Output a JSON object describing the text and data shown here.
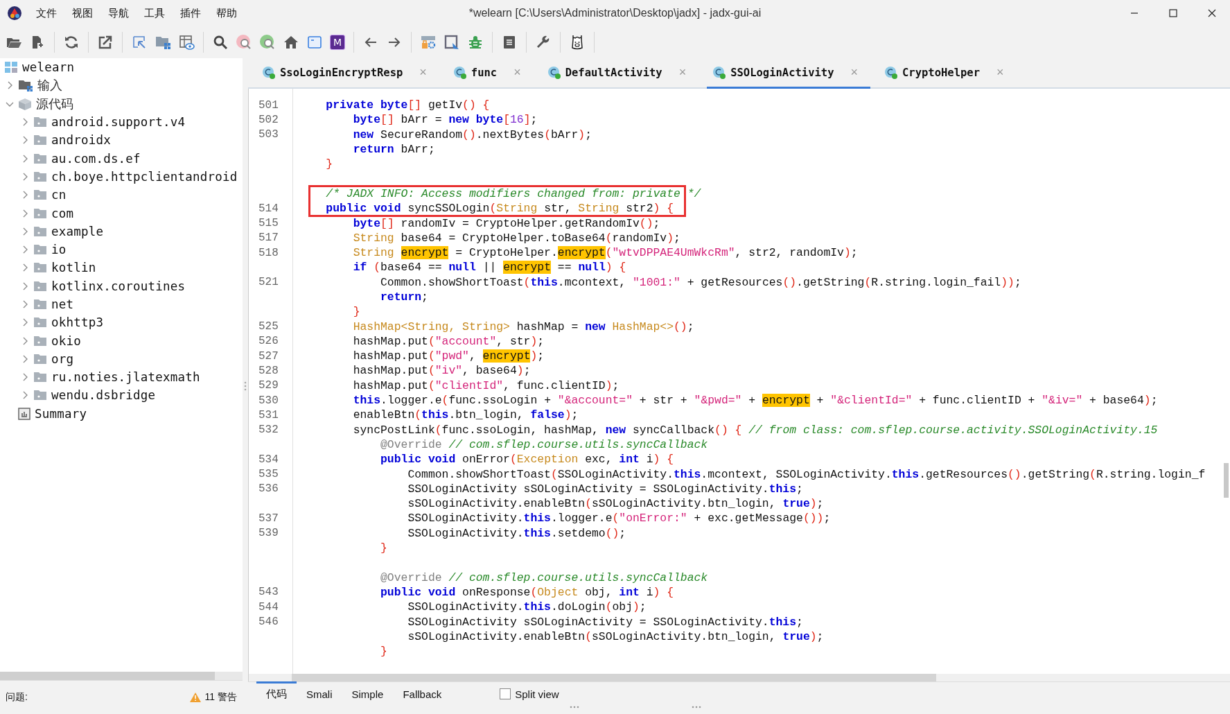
{
  "window": {
    "title": "*welearn [C:\\Users\\Administrator\\Desktop\\jadx] - jadx-gui-ai"
  },
  "menu": [
    "文件",
    "视图",
    "导航",
    "工具",
    "插件",
    "帮助"
  ],
  "toolbar": {
    "badge_letter": "M"
  },
  "tree": {
    "label": "welearn",
    "kind": "project",
    "children": [
      {
        "label": "输入",
        "kind": "input",
        "expanded": false
      },
      {
        "label": "源代码",
        "kind": "source",
        "expanded": true,
        "children": [
          {
            "label": "android.support.v4",
            "kind": "package",
            "expanded": false
          },
          {
            "label": "androidx",
            "kind": "package",
            "expanded": false
          },
          {
            "label": "au.com.ds.ef",
            "kind": "package",
            "expanded": false
          },
          {
            "label": "ch.boye.httpclientandroid",
            "kind": "package",
            "expanded": false
          },
          {
            "label": "cn",
            "kind": "package",
            "expanded": false
          },
          {
            "label": "com",
            "kind": "package",
            "expanded": false
          },
          {
            "label": "example",
            "kind": "package",
            "expanded": false
          },
          {
            "label": "io",
            "kind": "package",
            "expanded": false
          },
          {
            "label": "kotlin",
            "kind": "package",
            "expanded": false
          },
          {
            "label": "kotlinx.coroutines",
            "kind": "package",
            "expanded": false
          },
          {
            "label": "net",
            "kind": "package",
            "expanded": false
          },
          {
            "label": "okhttp3",
            "kind": "package",
            "expanded": false
          },
          {
            "label": "okio",
            "kind": "package",
            "expanded": false
          },
          {
            "label": "org",
            "kind": "package",
            "expanded": false
          },
          {
            "label": "ru.noties.jlatexmath",
            "kind": "package",
            "expanded": false
          },
          {
            "label": "wendu.dsbridge",
            "kind": "package",
            "expanded": false
          }
        ]
      },
      {
        "label": "Summary",
        "kind": "summary"
      }
    ]
  },
  "problems": {
    "label": "问题:",
    "warnings": "11 警告"
  },
  "tabs": [
    {
      "label": "SsoLoginEncryptResp",
      "selected": false,
      "close": "×"
    },
    {
      "label": "func",
      "selected": false,
      "close": "×"
    },
    {
      "label": "DefaultActivity",
      "selected": false,
      "close": "×"
    },
    {
      "label": "SSOLoginActivity",
      "selected": true,
      "close": "×"
    },
    {
      "label": "CryptoHelper",
      "selected": false,
      "close": "×"
    }
  ],
  "code": [
    {
      "kind": "code",
      "number": "501",
      "tokens": [
        {
          "kind": "kw",
          "text": "    private byte"
        },
        {
          "kind": "br",
          "text": "[]"
        },
        {
          "kind": "plain",
          "text": " getIv"
        },
        {
          "kind": "br",
          "text": "() {"
        }
      ]
    },
    {
      "kind": "code",
      "number": "502",
      "tokens": [
        {
          "kind": "kw",
          "text": "        byte"
        },
        {
          "kind": "br",
          "text": "[]"
        },
        {
          "kind": "plain",
          "text": " bArr = "
        },
        {
          "kind": "kw",
          "text": "new byte"
        },
        {
          "kind": "br",
          "text": "["
        },
        {
          "kind": "num",
          "text": "16"
        },
        {
          "kind": "br",
          "text": "]"
        },
        {
          "kind": "plain",
          "text": ";"
        }
      ]
    },
    {
      "kind": "code",
      "number": "503",
      "tokens": [
        {
          "kind": "kw",
          "text": "        new"
        },
        {
          "kind": "plain",
          "text": " SecureRandom"
        },
        {
          "kind": "br",
          "text": "()"
        },
        {
          "kind": "plain",
          "text": ".nextBytes"
        },
        {
          "kind": "br",
          "text": "("
        },
        {
          "kind": "plain",
          "text": "bArr"
        },
        {
          "kind": "br",
          "text": ")"
        },
        {
          "kind": "plain",
          "text": ";"
        }
      ]
    },
    {
      "kind": "code",
      "tokens": [
        {
          "kind": "kw",
          "text": "        return"
        },
        {
          "kind": "plain",
          "text": " bArr;"
        }
      ]
    },
    {
      "kind": "code",
      "tokens": [
        {
          "kind": "br",
          "text": "    }"
        }
      ]
    },
    {
      "kind": "blank"
    },
    {
      "kind": "code",
      "boxed": true,
      "tokens": [
        {
          "kind": "cmt",
          "text": "    /* JADX INFO: Access modifiers changed from: private */"
        }
      ]
    },
    {
      "kind": "code",
      "boxed": true,
      "number": "514",
      "tokens": [
        {
          "kind": "kw",
          "text": "    public void"
        },
        {
          "kind": "plain",
          "text": " syncSSOLogin"
        },
        {
          "kind": "br",
          "text": "("
        },
        {
          "kind": "type",
          "text": "String"
        },
        {
          "kind": "plain",
          "text": " str, "
        },
        {
          "kind": "type",
          "text": "String"
        },
        {
          "kind": "plain",
          "text": " str2"
        },
        {
          "kind": "br",
          "text": ") {"
        }
      ]
    },
    {
      "kind": "code",
      "number": "515",
      "tokens": [
        {
          "kind": "kw",
          "text": "        byte"
        },
        {
          "kind": "br",
          "text": "[]"
        },
        {
          "kind": "plain",
          "text": " randomIv = CryptoHelper.getRandomIv"
        },
        {
          "kind": "br",
          "text": "()"
        },
        {
          "kind": "plain",
          "text": ";"
        }
      ]
    },
    {
      "kind": "code",
      "number": "517",
      "tokens": [
        {
          "kind": "type",
          "text": "        String"
        },
        {
          "kind": "plain",
          "text": " base64 = CryptoHelper.toBase64"
        },
        {
          "kind": "br",
          "text": "("
        },
        {
          "kind": "plain",
          "text": "randomIv"
        },
        {
          "kind": "br",
          "text": ")"
        },
        {
          "kind": "plain",
          "text": ";"
        }
      ]
    },
    {
      "kind": "code",
      "number": "518",
      "tokens": [
        {
          "kind": "type",
          "text": "        String "
        },
        {
          "kind": "hl",
          "text": "encrypt"
        },
        {
          "kind": "plain",
          "text": " = CryptoHelper."
        },
        {
          "kind": "hl",
          "text": "encrypt"
        },
        {
          "kind": "br",
          "text": "("
        },
        {
          "kind": "str",
          "text": "\"wtvDPPAE4UmWkcRm\""
        },
        {
          "kind": "plain",
          "text": ", str2, randomIv"
        },
        {
          "kind": "br",
          "text": ")"
        },
        {
          "kind": "plain",
          "text": ";"
        }
      ]
    },
    {
      "kind": "code",
      "tokens": [
        {
          "kind": "kw",
          "text": "        if"
        },
        {
          "kind": "br",
          "text": " ("
        },
        {
          "kind": "plain",
          "text": "base64 == "
        },
        {
          "kind": "kw",
          "text": "null"
        },
        {
          "kind": "plain",
          "text": " || "
        },
        {
          "kind": "hl",
          "text": "encrypt"
        },
        {
          "kind": "plain",
          "text": " == "
        },
        {
          "kind": "kw",
          "text": "null"
        },
        {
          "kind": "br",
          "text": ") {"
        }
      ]
    },
    {
      "kind": "code",
      "number": "521",
      "tokens": [
        {
          "kind": "plain",
          "text": "            Common.showShortToast"
        },
        {
          "kind": "br",
          "text": "("
        },
        {
          "kind": "kw",
          "text": "this"
        },
        {
          "kind": "plain",
          "text": ".mcontext, "
        },
        {
          "kind": "str",
          "text": "\"1001:\""
        },
        {
          "kind": "plain",
          "text": " + getResources"
        },
        {
          "kind": "br",
          "text": "()"
        },
        {
          "kind": "plain",
          "text": ".getString"
        },
        {
          "kind": "br",
          "text": "("
        },
        {
          "kind": "plain",
          "text": "R.string.login_fail"
        },
        {
          "kind": "br",
          "text": "))"
        },
        {
          "kind": "plain",
          "text": ";"
        }
      ]
    },
    {
      "kind": "code",
      "tokens": [
        {
          "kind": "kw",
          "text": "            return"
        },
        {
          "kind": "plain",
          "text": ";"
        }
      ]
    },
    {
      "kind": "code",
      "tokens": [
        {
          "kind": "br",
          "text": "        }"
        }
      ]
    },
    {
      "kind": "code",
      "number": "525",
      "tokens": [
        {
          "kind": "type",
          "text": "        HashMap<String, String>"
        },
        {
          "kind": "plain",
          "text": " hashMap = "
        },
        {
          "kind": "kw",
          "text": "new"
        },
        {
          "kind": "type",
          "text": " HashMap<>"
        },
        {
          "kind": "br",
          "text": "()"
        },
        {
          "kind": "plain",
          "text": ";"
        }
      ]
    },
    {
      "kind": "code",
      "number": "526",
      "tokens": [
        {
          "kind": "plain",
          "text": "        hashMap.put"
        },
        {
          "kind": "br",
          "text": "("
        },
        {
          "kind": "str",
          "text": "\"account\""
        },
        {
          "kind": "plain",
          "text": ", str"
        },
        {
          "kind": "br",
          "text": ")"
        },
        {
          "kind": "plain",
          "text": ";"
        }
      ]
    },
    {
      "kind": "code",
      "number": "527",
      "tokens": [
        {
          "kind": "plain",
          "text": "        hashMap.put"
        },
        {
          "kind": "br",
          "text": "("
        },
        {
          "kind": "str",
          "text": "\"pwd\""
        },
        {
          "kind": "plain",
          "text": ", "
        },
        {
          "kind": "hl",
          "text": "encrypt"
        },
        {
          "kind": "br",
          "text": ")"
        },
        {
          "kind": "plain",
          "text": ";"
        }
      ]
    },
    {
      "kind": "code",
      "number": "528",
      "tokens": [
        {
          "kind": "plain",
          "text": "        hashMap.put"
        },
        {
          "kind": "br",
          "text": "("
        },
        {
          "kind": "str",
          "text": "\"iv\""
        },
        {
          "kind": "plain",
          "text": ", base64"
        },
        {
          "kind": "br",
          "text": ")"
        },
        {
          "kind": "plain",
          "text": ";"
        }
      ]
    },
    {
      "kind": "code",
      "number": "529",
      "tokens": [
        {
          "kind": "plain",
          "text": "        hashMap.put"
        },
        {
          "kind": "br",
          "text": "("
        },
        {
          "kind": "str",
          "text": "\"clientId\""
        },
        {
          "kind": "plain",
          "text": ", func.clientID"
        },
        {
          "kind": "br",
          "text": ")"
        },
        {
          "kind": "plain",
          "text": ";"
        }
      ]
    },
    {
      "kind": "code",
      "number": "530",
      "tokens": [
        {
          "kind": "kw",
          "text": "        this"
        },
        {
          "kind": "plain",
          "text": ".logger.e"
        },
        {
          "kind": "br",
          "text": "("
        },
        {
          "kind": "plain",
          "text": "func.ssoLogin + "
        },
        {
          "kind": "str",
          "text": "\"&account=\""
        },
        {
          "kind": "plain",
          "text": " + str + "
        },
        {
          "kind": "str",
          "text": "\"&pwd=\""
        },
        {
          "kind": "plain",
          "text": " + "
        },
        {
          "kind": "hl",
          "text": "encrypt"
        },
        {
          "kind": "plain",
          "text": " + "
        },
        {
          "kind": "str",
          "text": "\"&clientId=\""
        },
        {
          "kind": "plain",
          "text": " + func.clientID + "
        },
        {
          "kind": "str",
          "text": "\"&iv=\""
        },
        {
          "kind": "plain",
          "text": " + base64"
        },
        {
          "kind": "br",
          "text": ")"
        },
        {
          "kind": "plain",
          "text": ";"
        }
      ]
    },
    {
      "kind": "code",
      "number": "531",
      "tokens": [
        {
          "kind": "plain",
          "text": "        enableBtn"
        },
        {
          "kind": "br",
          "text": "("
        },
        {
          "kind": "kw",
          "text": "this"
        },
        {
          "kind": "plain",
          "text": ".btn_login, "
        },
        {
          "kind": "kw",
          "text": "false"
        },
        {
          "kind": "br",
          "text": ")"
        },
        {
          "kind": "plain",
          "text": ";"
        }
      ]
    },
    {
      "kind": "code",
      "number": "532",
      "tokens": [
        {
          "kind": "plain",
          "text": "        syncPostLink"
        },
        {
          "kind": "br",
          "text": "("
        },
        {
          "kind": "plain",
          "text": "func.ssoLogin, hashMap, "
        },
        {
          "kind": "kw",
          "text": "new"
        },
        {
          "kind": "plain",
          "text": " syncCallback"
        },
        {
          "kind": "br",
          "text": "() {"
        },
        {
          "kind": "cmt",
          "text": " // from class: com.sflep.course.activity.SSOLoginActivity.15"
        }
      ]
    },
    {
      "kind": "code",
      "tokens": [
        {
          "kind": "ann",
          "text": "            @Override"
        },
        {
          "kind": "cmt",
          "text": " // com.sflep.course.utils.syncCallback"
        }
      ]
    },
    {
      "kind": "code",
      "number": "534",
      "tokens": [
        {
          "kind": "kw",
          "text": "            public void"
        },
        {
          "kind": "plain",
          "text": " onError"
        },
        {
          "kind": "br",
          "text": "("
        },
        {
          "kind": "type",
          "text": "Exception"
        },
        {
          "kind": "plain",
          "text": " exc, "
        },
        {
          "kind": "kw",
          "text": "int"
        },
        {
          "kind": "plain",
          "text": " i"
        },
        {
          "kind": "br",
          "text": ") {"
        }
      ]
    },
    {
      "kind": "code",
      "number": "535",
      "tokens": [
        {
          "kind": "plain",
          "text": "                Common.showShortToast"
        },
        {
          "kind": "br",
          "text": "("
        },
        {
          "kind": "plain",
          "text": "SSOLoginActivity."
        },
        {
          "kind": "kw",
          "text": "this"
        },
        {
          "kind": "plain",
          "text": ".mcontext, SSOLoginActivity."
        },
        {
          "kind": "kw",
          "text": "this"
        },
        {
          "kind": "plain",
          "text": ".getResources"
        },
        {
          "kind": "br",
          "text": "()"
        },
        {
          "kind": "plain",
          "text": ".getString"
        },
        {
          "kind": "br",
          "text": "("
        },
        {
          "kind": "plain",
          "text": "R.string.login_f"
        }
      ]
    },
    {
      "kind": "code",
      "number": "536",
      "tokens": [
        {
          "kind": "plain",
          "text": "                SSOLoginActivity sSOLoginActivity = SSOLoginActivity."
        },
        {
          "kind": "kw",
          "text": "this"
        },
        {
          "kind": "plain",
          "text": ";"
        }
      ]
    },
    {
      "kind": "code",
      "tokens": [
        {
          "kind": "plain",
          "text": "                sSOLoginActivity.enableBtn"
        },
        {
          "kind": "br",
          "text": "("
        },
        {
          "kind": "plain",
          "text": "sSOLoginActivity.btn_login, "
        },
        {
          "kind": "kw",
          "text": "true"
        },
        {
          "kind": "br",
          "text": ")"
        },
        {
          "kind": "plain",
          "text": ";"
        }
      ]
    },
    {
      "kind": "code",
      "number": "537",
      "tokens": [
        {
          "kind": "plain",
          "text": "                SSOLoginActivity."
        },
        {
          "kind": "kw",
          "text": "this"
        },
        {
          "kind": "plain",
          "text": ".logger.e"
        },
        {
          "kind": "br",
          "text": "("
        },
        {
          "kind": "str",
          "text": "\"onError:\""
        },
        {
          "kind": "plain",
          "text": " + exc.getMessage"
        },
        {
          "kind": "br",
          "text": "())"
        },
        {
          "kind": "plain",
          "text": ";"
        }
      ]
    },
    {
      "kind": "code",
      "number": "539",
      "tokens": [
        {
          "kind": "plain",
          "text": "                SSOLoginActivity."
        },
        {
          "kind": "kw",
          "text": "this"
        },
        {
          "kind": "plain",
          "text": ".setdemo"
        },
        {
          "kind": "br",
          "text": "()"
        },
        {
          "kind": "plain",
          "text": ";"
        }
      ]
    },
    {
      "kind": "code",
      "tokens": [
        {
          "kind": "br",
          "text": "            }"
        }
      ]
    },
    {
      "kind": "blank"
    },
    {
      "kind": "code",
      "tokens": [
        {
          "kind": "ann",
          "text": "            @Override"
        },
        {
          "kind": "cmt",
          "text": " // com.sflep.course.utils.syncCallback"
        }
      ]
    },
    {
      "kind": "code",
      "number": "543",
      "tokens": [
        {
          "kind": "kw",
          "text": "            public void"
        },
        {
          "kind": "plain",
          "text": " onResponse"
        },
        {
          "kind": "br",
          "text": "("
        },
        {
          "kind": "type",
          "text": "Object"
        },
        {
          "kind": "plain",
          "text": " obj, "
        },
        {
          "kind": "kw",
          "text": "int"
        },
        {
          "kind": "plain",
          "text": " i"
        },
        {
          "kind": "br",
          "text": ") {"
        }
      ]
    },
    {
      "kind": "code",
      "number": "544",
      "tokens": [
        {
          "kind": "plain",
          "text": "                SSOLoginActivity."
        },
        {
          "kind": "kw",
          "text": "this"
        },
        {
          "kind": "plain",
          "text": ".doLogin"
        },
        {
          "kind": "br",
          "text": "("
        },
        {
          "kind": "plain",
          "text": "obj"
        },
        {
          "kind": "br",
          "text": ")"
        },
        {
          "kind": "plain",
          "text": ";"
        }
      ]
    },
    {
      "kind": "code",
      "number": "546",
      "tokens": [
        {
          "kind": "plain",
          "text": "                SSOLoginActivity sSOLoginActivity = SSOLoginActivity."
        },
        {
          "kind": "kw",
          "text": "this"
        },
        {
          "kind": "plain",
          "text": ";"
        }
      ]
    },
    {
      "kind": "code",
      "tokens": [
        {
          "kind": "plain",
          "text": "                sSOLoginActivity.enableBtn"
        },
        {
          "kind": "br",
          "text": "("
        },
        {
          "kind": "plain",
          "text": "sSOLoginActivity.btn_login, "
        },
        {
          "kind": "kw",
          "text": "true"
        },
        {
          "kind": "br",
          "text": ")"
        },
        {
          "kind": "plain",
          "text": ";"
        }
      ]
    },
    {
      "kind": "code",
      "tokens": [
        {
          "kind": "br",
          "text": "            }"
        }
      ]
    }
  ],
  "view_tabs": [
    {
      "label": "代码",
      "selected": true
    },
    {
      "label": "Smali",
      "selected": false
    },
    {
      "label": "Simple",
      "selected": false
    },
    {
      "label": "Fallback",
      "selected": false
    }
  ],
  "split_view": {
    "label": "Split view",
    "checked": false
  }
}
